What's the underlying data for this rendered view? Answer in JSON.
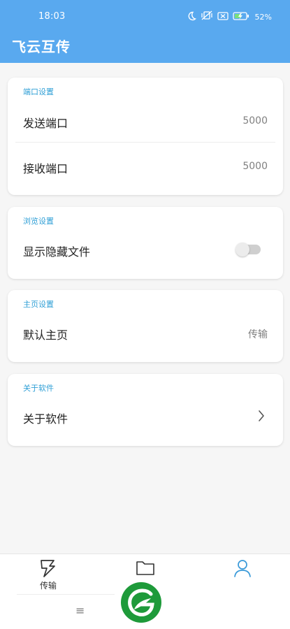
{
  "status_bar": {
    "time": "18:03",
    "battery_percent": "52%",
    "icons": [
      "moon-icon",
      "mute-vibrate-icon",
      "sim-error-icon",
      "battery-charging-icon"
    ]
  },
  "app_bar": {
    "title": "飞云互传"
  },
  "sections": [
    {
      "title": "端口设置",
      "rows": [
        {
          "label": "发送端口",
          "value": "5000"
        },
        {
          "label": "接收端口",
          "value": "5000"
        }
      ]
    },
    {
      "title": "浏览设置",
      "rows": [
        {
          "label": "显示隐藏文件",
          "toggle_on": false
        }
      ]
    },
    {
      "title": "主页设置",
      "rows": [
        {
          "label": "默认主页",
          "value": "传输"
        }
      ]
    },
    {
      "title": "关于软件",
      "rows": [
        {
          "label": "关于软件",
          "icon": "chevron-right-icon"
        }
      ]
    }
  ],
  "bottom_nav": {
    "items": [
      {
        "label": "传输",
        "icon": "lightning-icon",
        "active": false
      },
      {
        "label": "",
        "icon": "folder-icon",
        "active": false
      },
      {
        "label": "",
        "icon": "person-icon",
        "active": true
      }
    ]
  },
  "system_bar": {
    "menu_glyph": "≡"
  },
  "colors": {
    "primary": "#59a9ef",
    "section_title": "#2f9fd6",
    "active_nav": "#3a9ad9",
    "logo_green": "#1e9a3a"
  }
}
